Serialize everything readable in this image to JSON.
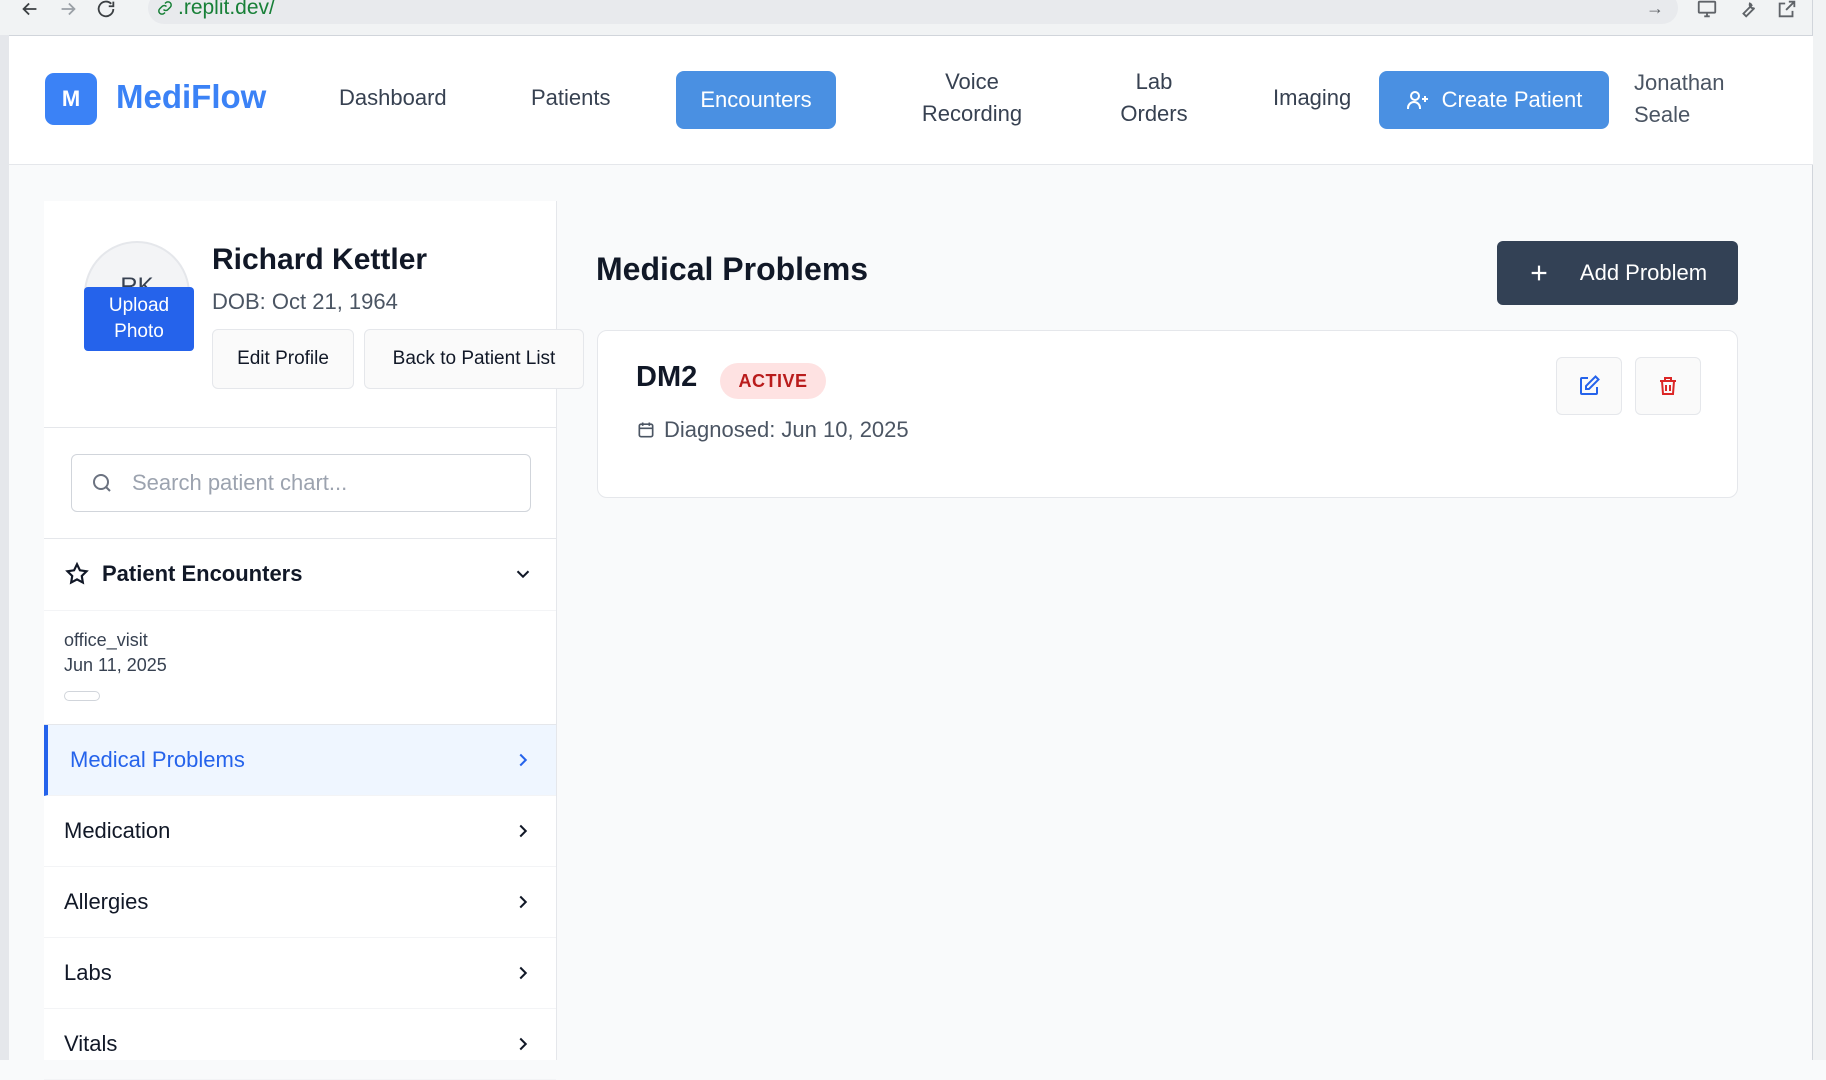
{
  "browser": {
    "url_domain": ".replit.dev/"
  },
  "app": {
    "logo_letter": "M",
    "name": "MediFlow"
  },
  "nav": {
    "dashboard": "Dashboard",
    "patients": "Patients",
    "encounters": "Encounters",
    "voice_line1": "Voice",
    "voice_line2": "Recording",
    "lab_line1": "Lab",
    "lab_line2": "Orders",
    "imaging": "Imaging",
    "create_patient": "Create Patient",
    "user_line1": "Jonathan",
    "user_line2": "Seale"
  },
  "patient": {
    "initials": "RK",
    "upload_line1": "Upload",
    "upload_line2": "Photo",
    "name": "Richard Kettler",
    "dob": "DOB: Oct 21, 1964",
    "edit_profile": "Edit Profile",
    "back_to_list": "Back to Patient List"
  },
  "search": {
    "placeholder": "Search patient chart..."
  },
  "encounters": {
    "title": "Patient Encounters",
    "items": [
      {
        "type": "office_visit",
        "date": "Jun 11, 2025"
      }
    ]
  },
  "sections": [
    {
      "label": "Medical Problems"
    },
    {
      "label": "Medication"
    },
    {
      "label": "Allergies"
    },
    {
      "label": "Labs"
    },
    {
      "label": "Vitals"
    }
  ],
  "main": {
    "title": "Medical Problems",
    "add_button": "Add Problem",
    "problems": [
      {
        "name": "DM2",
        "status": "ACTIVE",
        "diagnosed": "Diagnosed: Jun 10, 2025"
      }
    ]
  },
  "colors": {
    "brand": "#3b82f6",
    "nav_active": "#4a90e2",
    "add_button": "#334155",
    "status_active_bg": "#fee2e2",
    "status_active_text": "#b91c1c"
  }
}
